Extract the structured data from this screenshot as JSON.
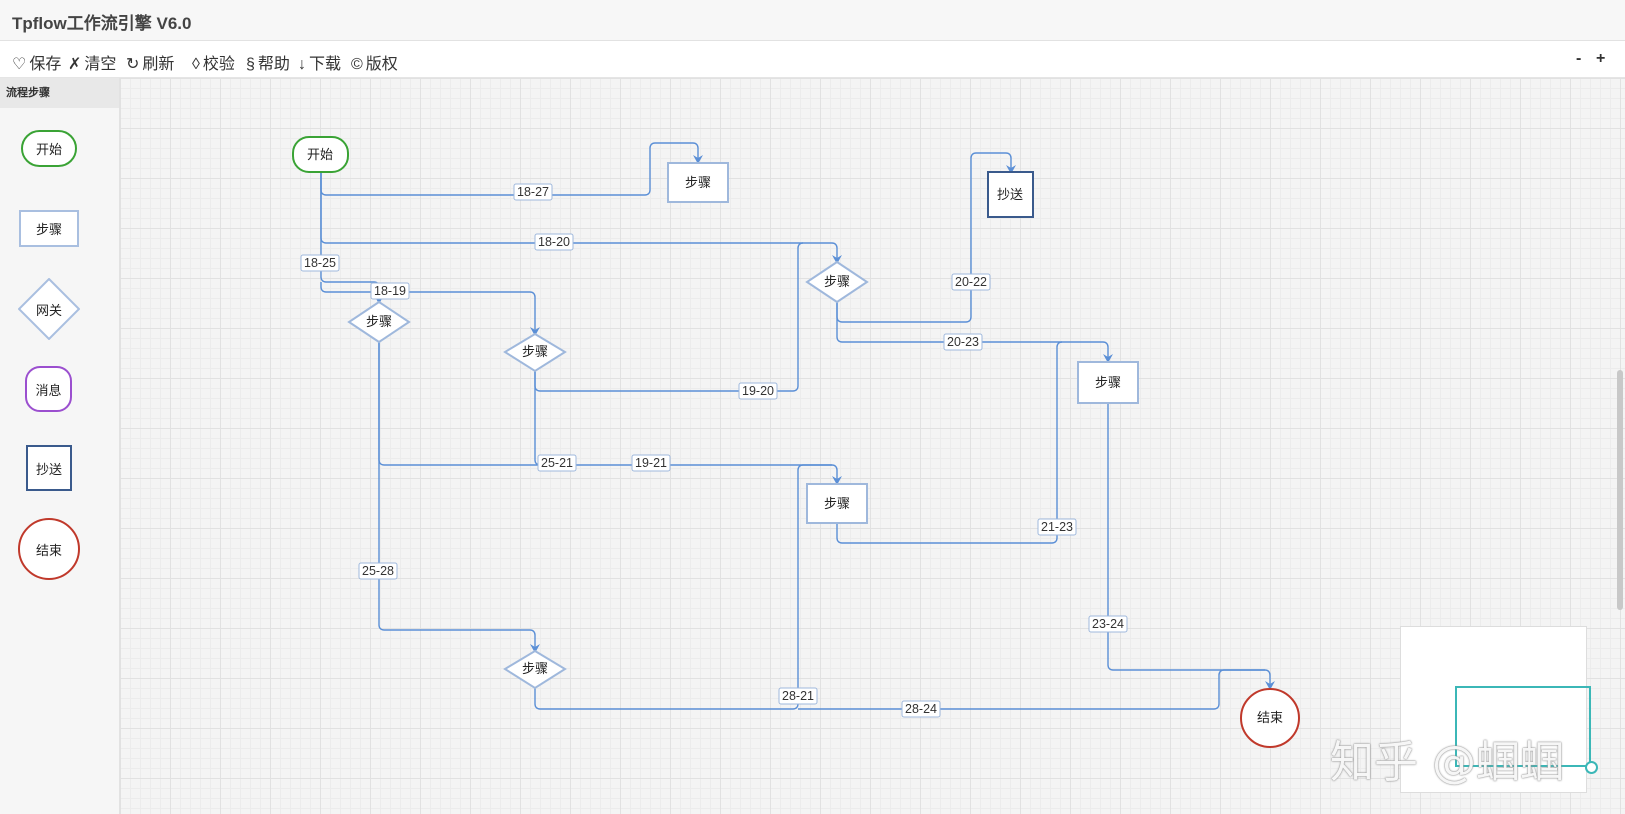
{
  "app": {
    "title": "Tpflow工作流引擎 V6.0"
  },
  "toolbar": {
    "items": [
      {
        "icon": "♡",
        "label": "保存"
      },
      {
        "icon": "✗",
        "label": "清空"
      },
      {
        "icon": "↻",
        "label": "刷新"
      },
      {
        "icon": "◊",
        "label": "校验"
      },
      {
        "icon": "§",
        "label": "帮助"
      },
      {
        "icon": "↓",
        "label": "下载"
      },
      {
        "icon": "©",
        "label": "版权"
      }
    ],
    "zoom_out": "-",
    "zoom_in": "+"
  },
  "sidebar": {
    "title": "流程步骤",
    "palette": [
      {
        "type": "start",
        "label": "开始"
      },
      {
        "type": "step",
        "label": "步骤"
      },
      {
        "type": "gateway",
        "label": "网关"
      },
      {
        "type": "message",
        "label": "消息"
      },
      {
        "type": "cc",
        "label": "抄送"
      },
      {
        "type": "end",
        "label": "结束"
      }
    ]
  },
  "flow": {
    "colors": {
      "edge": "#5b8fd6",
      "step_border": "#9fb8dc",
      "start": "#3aa335",
      "end": "#c0392b",
      "cc": "#3a5a8c"
    },
    "nodes": {
      "start": "开始",
      "s27": "步骤",
      "cc22": "抄送",
      "g20": "步骤",
      "g25": "步骤",
      "g19": "步骤",
      "s23": "步骤",
      "s21": "步骤",
      "g28": "步骤",
      "end24": "结束"
    },
    "edges": {
      "e18_27": "18-27",
      "e18_20": "18-20",
      "e18_25": "18-25",
      "e18_19": "18-19",
      "e20_22": "20-22",
      "e20_23": "20-23",
      "e19_20": "19-20",
      "e25_21": "25-21",
      "e19_21": "19-21",
      "e21_23": "21-23",
      "e25_28": "25-28",
      "e23_24": "23-24",
      "e28_21": "28-21",
      "e28_24": "28-24"
    }
  },
  "watermark": "知乎 @蝈蝈"
}
